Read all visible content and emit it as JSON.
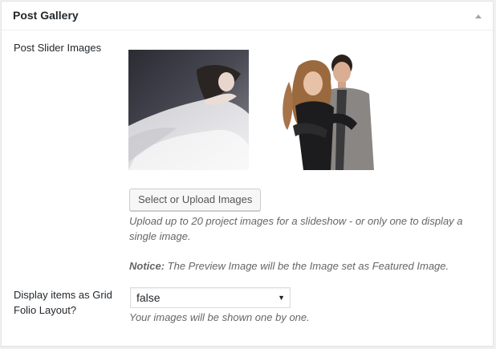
{
  "metabox": {
    "title": "Post Gallery",
    "toggle_icon": "triangle-up-icon"
  },
  "slider": {
    "label": "Post Slider Images",
    "images": [
      {
        "name": "woman-in-white-dress-photo"
      },
      {
        "name": "couple-portrait-photo"
      }
    ],
    "button_label": "Select or Upload Images",
    "help_text_line1": "Upload up to 20 project images for a slideshow - or only one to display a",
    "help_text_line2": "single image.",
    "notice_label": "Notice:",
    "notice_text": " The Preview Image will be the Image set as Featured Image."
  },
  "grid_folio": {
    "label_line1": "Display items as Grid",
    "label_line2": "Folio Layout?",
    "selected_value": "false",
    "help_text": "Your images will be shown one by one."
  },
  "colors": {
    "background": "#f1f1f1",
    "panel": "#ffffff",
    "border": "#e5e5e5",
    "button_bg": "#f7f7f7",
    "muted_text": "#666666"
  }
}
